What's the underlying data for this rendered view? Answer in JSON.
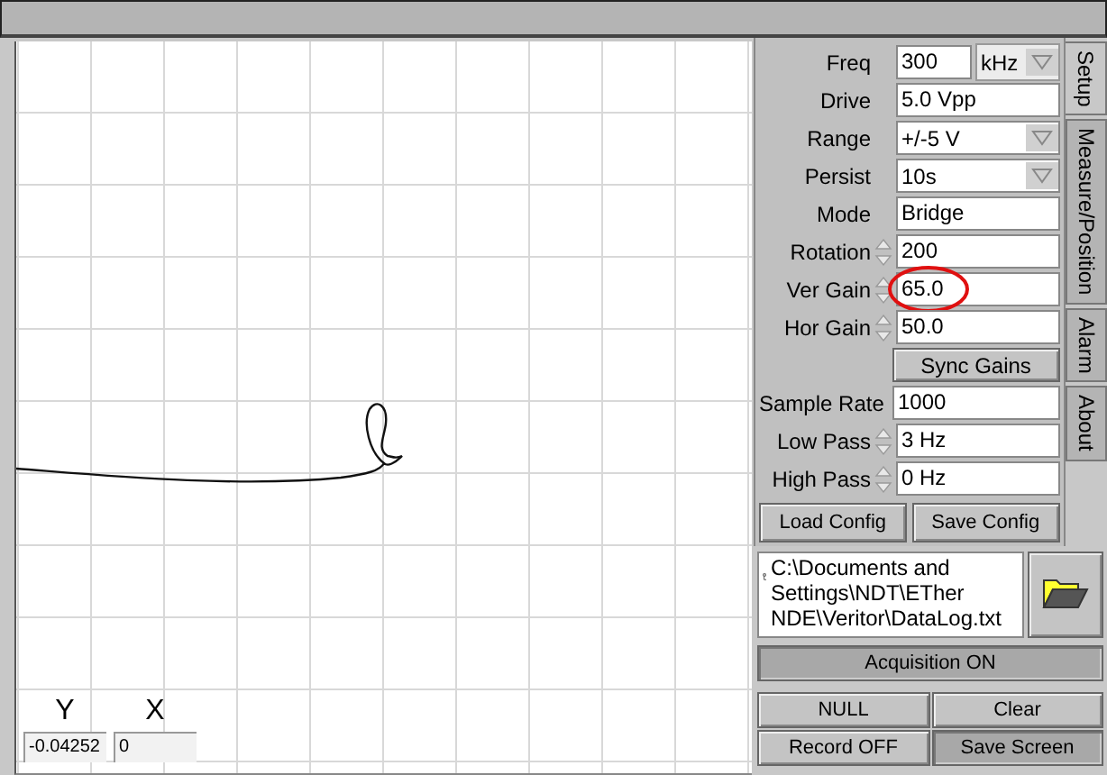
{
  "plot": {
    "y_label": "Y",
    "x_label": "X",
    "y_value": "-0.04252",
    "x_value": "0"
  },
  "tabs": [
    {
      "label": "Setup",
      "selected": true
    },
    {
      "label": "Measure/Position",
      "selected": false
    },
    {
      "label": "Alarm",
      "selected": false
    },
    {
      "label": "About",
      "selected": false
    }
  ],
  "fields": [
    {
      "kind": "unit",
      "label": "Freq",
      "value": "300",
      "unit": "kHz"
    },
    {
      "kind": "text",
      "label": "Drive",
      "value": "5.0 Vpp"
    },
    {
      "kind": "dropdown",
      "label": "Range",
      "value": "+/-5 V"
    },
    {
      "kind": "dropdown",
      "label": "Persist",
      "value": "10s"
    },
    {
      "kind": "text",
      "label": "Mode",
      "value": "Bridge"
    },
    {
      "kind": "spinner",
      "label": "Rotation",
      "value": "200",
      "circled": false
    },
    {
      "kind": "spinner",
      "label": "Ver Gain",
      "value": "65.0",
      "circled": true
    },
    {
      "kind": "spinner",
      "label": "Hor Gain",
      "value": "50.0",
      "circled": false
    },
    {
      "kind": "button",
      "label": "Sync Gains"
    },
    {
      "kind": "text",
      "label": "Sample Rate",
      "value": "1000"
    },
    {
      "kind": "spinner",
      "label": "Low Pass",
      "value": "3 Hz",
      "circled": false
    },
    {
      "kind": "spinner",
      "label": "High Pass",
      "value": "0 Hz",
      "circled": false
    }
  ],
  "config_buttons": [
    "Load Config",
    "Save Config"
  ],
  "file_path": "C:\\Documents and Settings\\NDT\\ETher NDE\\Veritor\\DataLog.txt",
  "acquisition": {
    "label": "Acquisition ON",
    "pressed": true
  },
  "buttons": [
    {
      "label": "NULL",
      "pressed": false
    },
    {
      "label": "Clear",
      "pressed": false
    },
    {
      "label": "Record OFF",
      "pressed": false
    },
    {
      "label": "Save Screen",
      "pressed": true
    }
  ]
}
